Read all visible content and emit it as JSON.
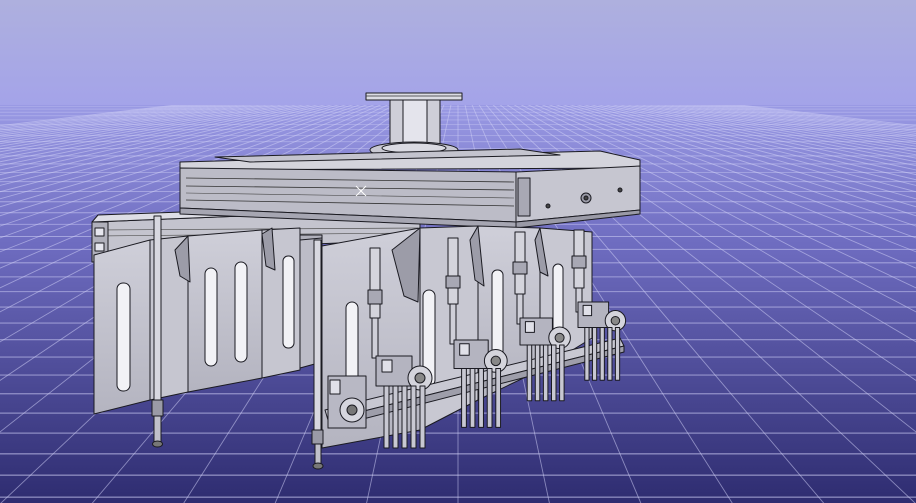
{
  "colors": {
    "sky_top": "#a7a8dc",
    "sky_bottom": "#9f9ee8",
    "floor_far": "#8f8fd6",
    "floor_near": "#3a3880",
    "grid_line": "#c8c9f2",
    "part_light": "#d6d6df",
    "part_mid": "#b9b9c4",
    "part_dark": "#8e8e99",
    "edge": "#1b1b22",
    "slot": "#f2f2f6"
  },
  "icons": {
    "origin_marker": "cross-icon"
  }
}
